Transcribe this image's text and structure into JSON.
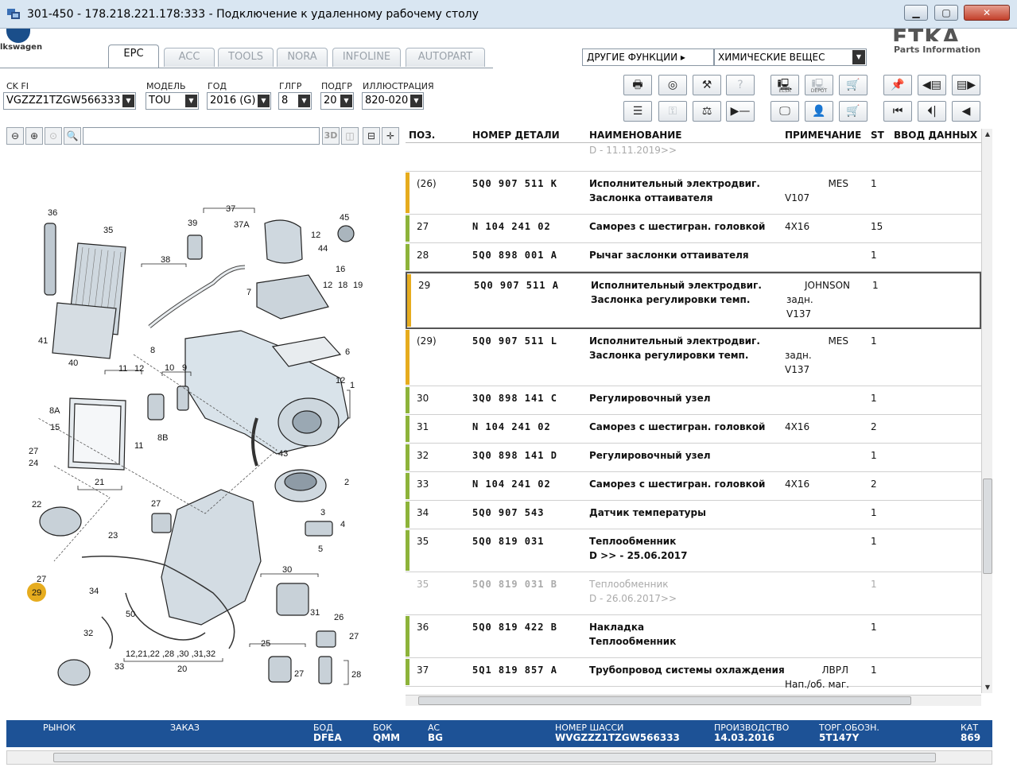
{
  "window": {
    "title": "301-450 - 178.218.221.178:333 - Подключение к удаленному рабочему столу"
  },
  "brand": {
    "vw_text": "lkswagen",
    "etka": "ETKA",
    "etka_sub": "Parts Information"
  },
  "tabs": [
    {
      "label": "EPC"
    },
    {
      "label": "ACC"
    },
    {
      "label": "TOOLS"
    },
    {
      "label": "NORA"
    },
    {
      "label": "INFOLINE"
    },
    {
      "label": "AUTOPART"
    }
  ],
  "functions": {
    "label": "ДРУГИЕ ФУНКЦИИ ▸",
    "value": "ХИМИЧЕСКИЕ ВЕЩЕС"
  },
  "filters": [
    {
      "label": "CK FI",
      "value": "VGZZZ1TZGW566333"
    },
    {
      "label": "МОДЕЛЬ",
      "value": "TOU"
    },
    {
      "label": "ГОД",
      "value": "2016 (G)"
    },
    {
      "label": "ГЛГР",
      "value": "8"
    },
    {
      "label": "ПОДГР",
      "value": "20"
    },
    {
      "label": "ИЛЛЮСТРАЦИЯ",
      "value": "820-020"
    }
  ],
  "toolbar": {
    "elsa": "ELSA",
    "depot": "DEPOT"
  },
  "diagram_tools": {
    "tool_3d": "3D"
  },
  "table": {
    "headers": {
      "pos": "ПОЗ.",
      "num": "НОМЕР ДЕТАЛИ",
      "name": "НАИМЕНОВАНИЕ",
      "note": "ПРИМЕЧАНИЕ",
      "st": "ST",
      "input": "ВВОД ДАННЫХ П"
    },
    "rows": [
      {
        "pos": "",
        "num": "",
        "name": "D - 11.11.2019>>",
        "name2": "",
        "note": "",
        "note2": "",
        "note3": "",
        "st": "",
        "grey": true,
        "bar": ""
      },
      {
        "pos": "(26)",
        "num": "5Q0 907 511 K",
        "name": "Исполнительный электродвиг.",
        "name2": "Заслонка оттаивателя",
        "note": "MES",
        "note2": "V107",
        "note3": "",
        "st": "1",
        "bar": "#e6ac1e"
      },
      {
        "pos": "27",
        "num": "N   104 241 02",
        "name": "Саморез с шестигран. головкой",
        "name2": "",
        "note": "4X16",
        "note2": "",
        "note3": "",
        "st": "15",
        "bar": "#8db33a"
      },
      {
        "pos": "28",
        "num": "5Q0 898 001 A",
        "name": "Рычаг заслонки оттаивателя",
        "name2": "",
        "note": "",
        "note2": "",
        "note3": "",
        "st": "1",
        "bar": "#8db33a"
      },
      {
        "pos": "29",
        "num": "5Q0 907 511 A",
        "name": "Исполнительный электродвиг.",
        "name2": "Заслонка регулировки темп.",
        "note": "JOHNSON",
        "note2": "задн.",
        "note3": "V137",
        "st": "1",
        "bar": "#e6ac1e",
        "selected": true
      },
      {
        "pos": "(29)",
        "num": "5Q0 907 511 L",
        "name": "Исполнительный электродвиг.",
        "name2": "Заслонка регулировки темп.",
        "note": "MES",
        "note2": "задн.",
        "note3": "V137",
        "st": "1",
        "bar": "#e6ac1e"
      },
      {
        "pos": "30",
        "num": "3Q0 898 141 C",
        "name": "Регулировочный узел",
        "name2": "",
        "note": "",
        "note2": "",
        "note3": "",
        "st": "1",
        "bar": "#8db33a"
      },
      {
        "pos": "31",
        "num": "N   104 241 02",
        "name": "Саморез с шестигран. головкой",
        "name2": "",
        "note": "4X16",
        "note2": "",
        "note3": "",
        "st": "2",
        "bar": "#8db33a"
      },
      {
        "pos": "32",
        "num": "3Q0 898 141 D",
        "name": "Регулировочный узел",
        "name2": "",
        "note": "",
        "note2": "",
        "note3": "",
        "st": "1",
        "bar": "#8db33a"
      },
      {
        "pos": "33",
        "num": "N   104 241 02",
        "name": "Саморез с шестигран. головкой",
        "name2": "",
        "note": "4X16",
        "note2": "",
        "note3": "",
        "st": "2",
        "bar": "#8db33a"
      },
      {
        "pos": "34",
        "num": "5Q0 907 543",
        "name": "Датчик температуры",
        "name2": "",
        "note": "",
        "note2": "",
        "note3": "",
        "st": "1",
        "bar": "#8db33a"
      },
      {
        "pos": "35",
        "num": "5Q0 819 031",
        "name": "Теплообменник",
        "name2": "D            >> - 25.06.2017",
        "note": "",
        "note2": "",
        "note3": "",
        "st": "1",
        "bar": "#8db33a"
      },
      {
        "pos": "35",
        "num": "5Q0 819 031 B",
        "name": "Теплообменник",
        "name2": "D - 26.06.2017>>",
        "note": "",
        "note2": "",
        "note3": "",
        "st": "1",
        "grey": true,
        "bar": ""
      },
      {
        "pos": "36",
        "num": "5Q0 819 422 B",
        "name": "Накладка",
        "name2": "Теплообменник",
        "note": "",
        "note2": "",
        "note3": "",
        "st": "1",
        "bar": "#8db33a"
      },
      {
        "pos": "37",
        "num": "5Q1 819 857 A",
        "name": "Трубопровод системы охлаждения",
        "name2": "",
        "note": "ЛВРЛ",
        "note2": "Нап./об. маг.",
        "note3": "",
        "st": "1",
        "bar": "#8db33a"
      }
    ]
  },
  "status": {
    "market_label": "РЫНОК",
    "market_value": "",
    "order_label": "ЗАКАЗ",
    "order_value": "",
    "bod_label": "БОД",
    "bod_value": "DFEA",
    "bok_label": "БОК",
    "bok_value": "QMM",
    "ac_label": "AC",
    "ac_value": "BG",
    "vin_label": "НОМЕР ШАССИ",
    "vin_value": "WVGZZZ1TZGW566333",
    "prod_label": "ПРОИЗВОДСТВО",
    "prod_value": "14.03.2016",
    "trade_label": "ТОРГ.ОБОЗН.",
    "trade_value": "5T147Y",
    "cat_label": "КАТ",
    "cat_value": "869"
  },
  "diagram": {
    "callouts": [
      "36",
      "35",
      "39",
      "37",
      "37A",
      "12",
      "45",
      "38",
      "44",
      "16",
      "12",
      "18",
      "19",
      "7",
      "41",
      "40",
      "8",
      "6",
      "11",
      "12",
      "10",
      "9",
      "12",
      "1",
      "8A",
      "15",
      "11",
      "8B",
      "27",
      "24",
      "43",
      "21",
      "2",
      "22",
      "27",
      "3",
      "4",
      "23",
      "5",
      "27",
      "34",
      "30",
      "29",
      "50",
      "31",
      "26",
      "32",
      "33",
      "25",
      "27",
      "12,21,22 ,28 ,30 ,31,32",
      "20",
      "27",
      "28"
    ],
    "highlight": "29"
  }
}
